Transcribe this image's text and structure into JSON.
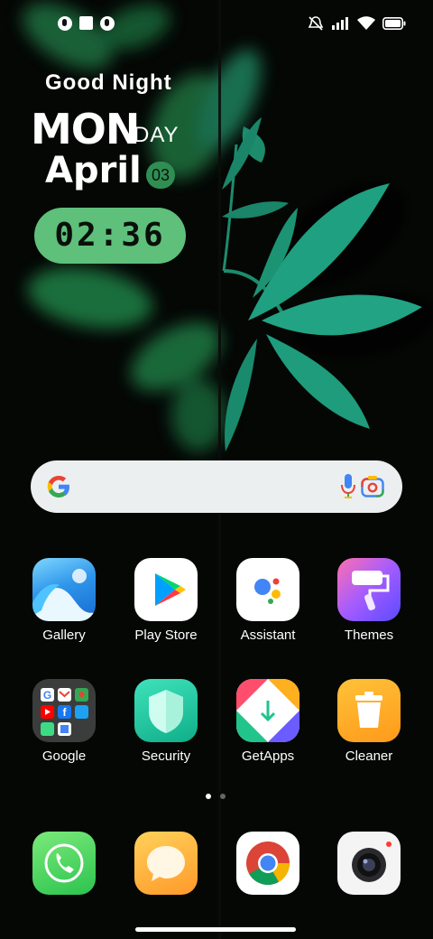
{
  "status_bar": {
    "left_icons": [
      "notification-icon",
      "square-icon",
      "notification-icon"
    ],
    "right_icons": [
      "muted-vibrate-icon",
      "signal-icon",
      "wifi-icon",
      "battery-icon"
    ]
  },
  "widget": {
    "greeting": "Good Night",
    "day_big": "MON",
    "day_small": "DAY",
    "month": "April",
    "date": "03",
    "time": "02:36"
  },
  "search": {
    "icons": [
      "google-g-icon",
      "microphone-icon",
      "google-lens-icon"
    ]
  },
  "apps": [
    {
      "label": "Gallery",
      "icon": "gallery-icon"
    },
    {
      "label": "Play Store",
      "icon": "play-store-icon"
    },
    {
      "label": "Assistant",
      "icon": "assistant-icon"
    },
    {
      "label": "Themes",
      "icon": "themes-icon"
    },
    {
      "label": "Google",
      "icon": "google-folder-icon"
    },
    {
      "label": "Security",
      "icon": "security-icon"
    },
    {
      "label": "GetApps",
      "icon": "getapps-icon"
    },
    {
      "label": "Cleaner",
      "icon": "cleaner-icon"
    }
  ],
  "dock": [
    {
      "icon": "phone-icon"
    },
    {
      "icon": "messages-icon"
    },
    {
      "icon": "chrome-icon"
    },
    {
      "icon": "camera-icon"
    }
  ],
  "pager": {
    "pages": 2,
    "current": 1
  },
  "colors": {
    "accent_green": "#5ec07a",
    "leaf_teal": "#1e9c7c"
  }
}
